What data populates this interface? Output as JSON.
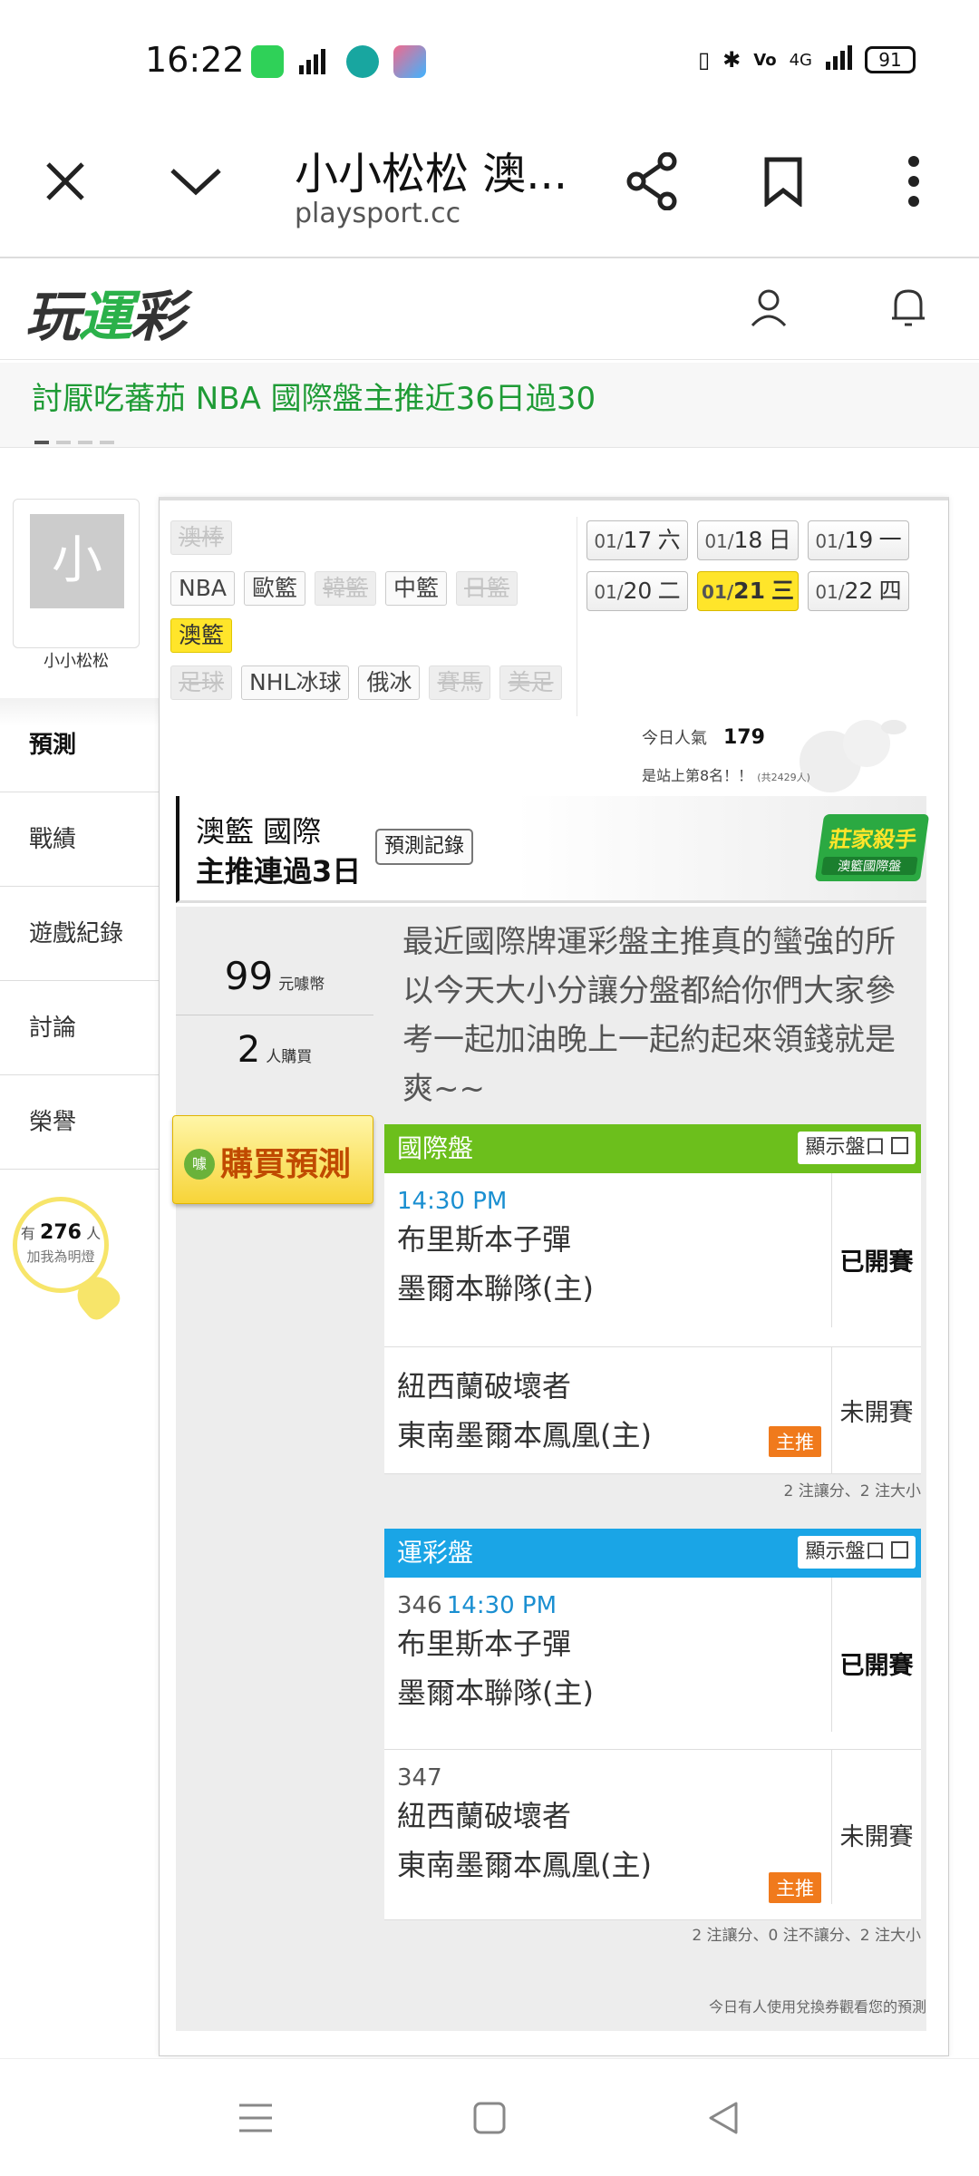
{
  "status_bar": {
    "time": "16:22",
    "battery": "91",
    "network": "4G"
  },
  "browser": {
    "title": "小小松松 澳...",
    "url": "playsport.cc"
  },
  "site": {
    "logo_part1": "玩",
    "logo_part2": "運",
    "logo_part3": "彩"
  },
  "marquee": {
    "text": "討厭吃蕃茄 NBA 國際盤主推近36日過30"
  },
  "user": {
    "avatar_char": "小",
    "name": "小小松松"
  },
  "sidebar": {
    "tabs": [
      {
        "label": "預測"
      },
      {
        "label": "戰績"
      },
      {
        "label": "遊戲紀錄"
      },
      {
        "label": "討論"
      },
      {
        "label": "榮譽"
      }
    ],
    "light": {
      "prefix": "有",
      "count": "276",
      "suffix": "人",
      "label": "加我為明燈"
    }
  },
  "categories": {
    "row1": [
      "澳棒"
    ],
    "row2": [
      "NBA",
      "歐籃",
      "韓籃",
      "中籃",
      "日籃"
    ],
    "row3": [
      "澳籃"
    ],
    "row4": [
      "足球",
      "NHL冰球",
      "俄冰",
      "賽馬",
      "美足"
    ]
  },
  "dates": [
    {
      "month": "01/",
      "day": "17",
      "weekday": "六"
    },
    {
      "month": "01/",
      "day": "18",
      "weekday": "日"
    },
    {
      "month": "01/",
      "day": "19",
      "weekday": "一"
    },
    {
      "month": "01/",
      "day": "20",
      "weekday": "二"
    },
    {
      "month": "01/",
      "day": "21",
      "weekday": "三"
    },
    {
      "month": "01/",
      "day": "22",
      "weekday": "四"
    }
  ],
  "stats": {
    "popularity_label": "今日人氣",
    "popularity": "179",
    "rank_text": "是站上第8名！！",
    "rank_total": "(共2429人)"
  },
  "banner": {
    "line1": "澳籃 國際",
    "line2": "主推連過3日",
    "record_button": "預測記錄",
    "badge_line1": "莊家殺手",
    "badge_line2": "澳籃國際盤"
  },
  "purchase": {
    "price": "99",
    "price_unit": "元噱幣",
    "buyers": "2",
    "buyers_unit": "人購買",
    "button": "購買預測",
    "coin": "噱"
  },
  "prediction_text": "最近國際牌運彩盤主推真的蠻強的所以今天大小分讓分盤都給你們大家參考一起加油晚上一起約起來領錢就是爽~~",
  "intl_odds": {
    "header": "國際盤",
    "show_button": "顯示盤口",
    "games": [
      {
        "time": "14:30 PM",
        "away": "布里斯本子彈",
        "home": "墨爾本聯隊(主)",
        "state": "已開賽"
      },
      {
        "time": "",
        "away": "紐西蘭破壞者",
        "home": "東南墨爾本鳳凰(主)",
        "state": "未開賽",
        "tag": "主推"
      }
    ],
    "footer": "2 注讓分、2 注大小"
  },
  "lottery_odds": {
    "header": "運彩盤",
    "show_button": "顯示盤口",
    "games": [
      {
        "number": "346",
        "time": "14:30 PM",
        "away": "布里斯本子彈",
        "home": "墨爾本聯隊(主)",
        "state": "已開賽"
      },
      {
        "number": "347",
        "time": "",
        "away": "紐西蘭破壞者",
        "home": "東南墨爾本鳳凰(主)",
        "state": "未開賽",
        "tag": "主推"
      }
    ],
    "footer": "2 注讓分、0 注不讓分、2 注大小"
  },
  "panel_footer": "今日有人使用兌換券觀看您的預測"
}
